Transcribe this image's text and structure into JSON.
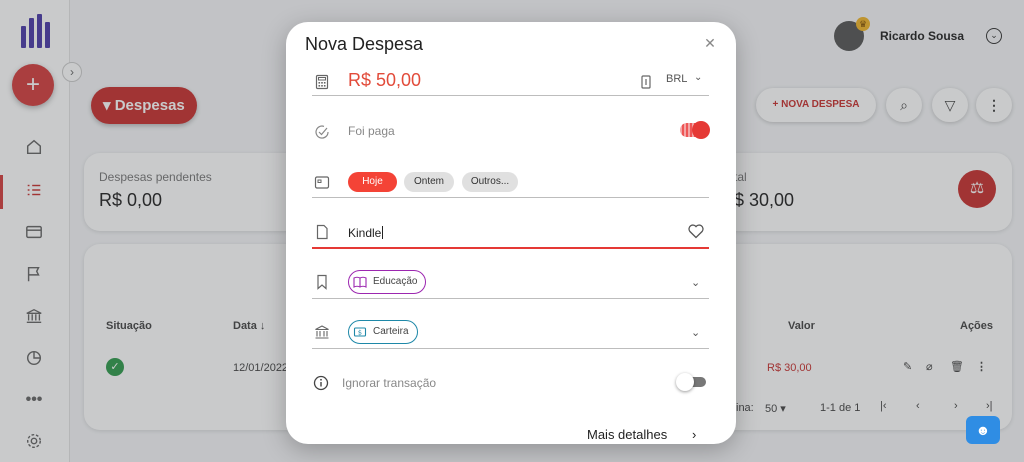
{
  "user": {
    "name": "Ricardo Sousa"
  },
  "header": {
    "section_chip": "Despesas",
    "new_button": "NOVA DESPESA"
  },
  "summary": {
    "pending_label": "Despesas pendentes",
    "pending_value": "R$ 0,00",
    "total_label_partial": "tal",
    "total_value_partial": "$ 30,00"
  },
  "table": {
    "columns": {
      "status": "Situação",
      "date": "Data ↓",
      "value": "Valor",
      "actions": "Ações"
    },
    "rows": [
      {
        "date": "12/01/2022",
        "value": "R$ 30,00"
      }
    ],
    "footer": {
      "rows_label_partial": "ina:",
      "rows_per_page": "50",
      "range": "1-1 de 1"
    }
  },
  "modal": {
    "title": "Nova Despesa",
    "amount": "R$ 50,00",
    "currency": "BRL",
    "paid_label": "Foi paga",
    "paid": true,
    "date_chips": [
      "Hoje",
      "Ontem",
      "Outros..."
    ],
    "selected_date_chip": "Hoje",
    "description": "Kindle",
    "category": {
      "label": "Educação",
      "color": "#9c27b0"
    },
    "account": {
      "label": "Carteira",
      "color": "#1e88a8"
    },
    "ignore_label": "Ignorar transação",
    "ignore": false,
    "more_details": "Mais detalhes"
  },
  "colors": {
    "accent": "#c8302f",
    "amount": "#e24b3a",
    "sidebar_logo": "#4a3aa8"
  }
}
